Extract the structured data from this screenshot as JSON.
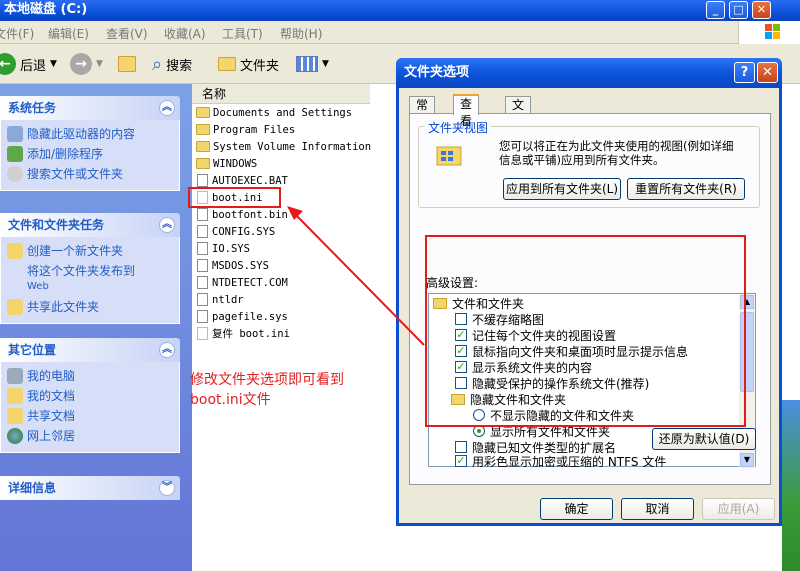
{
  "window": {
    "title": "本地磁盘 (C:)"
  },
  "menu": [
    "文件(F)",
    "编辑(E)",
    "查看(V)",
    "收藏(A)",
    "工具(T)",
    "帮助(H)"
  ],
  "toolbar": {
    "back": "后退",
    "search": "搜索",
    "folders": "文件夹"
  },
  "sidebar": {
    "system_tasks": {
      "title": "系统任务",
      "items": [
        "隐藏此驱动器的内容",
        "添加/删除程序",
        "搜索文件或文件夹"
      ]
    },
    "file_tasks": {
      "title": "文件和文件夹任务",
      "items": [
        "创建一个新文件夹",
        "将这个文件夹发布到",
        "Web",
        "共享此文件夹"
      ]
    },
    "other_places": {
      "title": "其它位置",
      "items": [
        "我的电脑",
        "我的文档",
        "共享文档",
        "网上邻居"
      ]
    },
    "details": {
      "title": "详细信息"
    }
  },
  "filelist": {
    "column": "名称",
    "files": [
      "Documents and Settings",
      "Program Files",
      "System Volume Information",
      "WINDOWS",
      "AUTOEXEC.BAT",
      "boot.ini",
      "bootfont.bin",
      "CONFIG.SYS",
      "IO.SYS",
      "MSDOS.SYS",
      "NTDETECT.COM",
      "ntldr",
      "pagefile.sys",
      "复件 boot.ini"
    ]
  },
  "annotation": {
    "line1": "修改文件夹选项即可看到",
    "line2": "boot.ini文件"
  },
  "dialog": {
    "title": "文件夹选项",
    "tabs": [
      "常规",
      "查看",
      "文件类型"
    ],
    "folder_views": {
      "label": "文件夹视图",
      "text1": "您可以将正在为此文件夹使用的视图(例如详细",
      "text2": "信息或平铺)应用到所有文件夹。",
      "apply_all": "应用到所有文件夹(L)",
      "reset_all": "重置所有文件夹(R)"
    },
    "advanced": {
      "label": "高级设置:",
      "items": [
        "文件和文件夹",
        "不缓存缩略图",
        "记住每个文件夹的视图设置",
        "鼠标指向文件夹和桌面项时显示提示信息",
        "显示系统文件夹的内容",
        "隐藏受保护的操作系统文件(推荐)",
        "隐藏文件和文件夹",
        "不显示隐藏的文件和文件夹",
        "显示所有文件和文件夹",
        "隐藏已知文件类型的扩展名",
        "用彩色显示加密或压缩的 NTFS 文件"
      ],
      "restore_defaults": "还原为默认值(D)"
    },
    "ok": "确定",
    "cancel": "取消",
    "apply": "应用(A)"
  },
  "colors": {
    "accent": "#215dc6",
    "title_blue": "#0a52d8",
    "highlight_red": "#e31b1b"
  }
}
